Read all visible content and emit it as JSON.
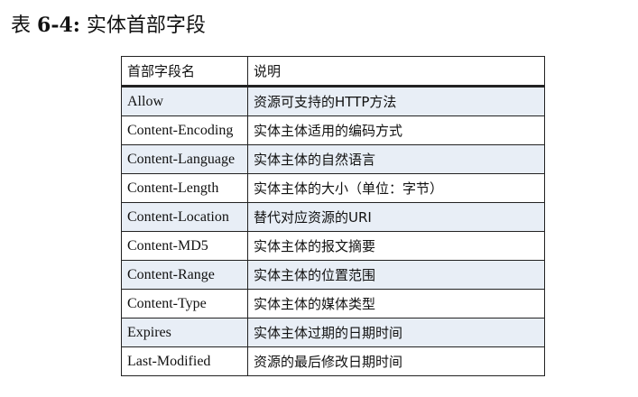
{
  "caption": {
    "prefix": "表",
    "number": "6-4:",
    "title": "实体首部字段"
  },
  "table": {
    "headers": {
      "name": "首部字段名",
      "desc": "说明"
    },
    "rows": [
      {
        "name": "Allow",
        "desc": "资源可支持的HTTP方法"
      },
      {
        "name": "Content-Encoding",
        "desc": "实体主体适用的编码方式"
      },
      {
        "name": "Content-Language",
        "desc": "实体主体的自然语言"
      },
      {
        "name": "Content-Length",
        "desc": "实体主体的大小（单位：字节）"
      },
      {
        "name": "Content-Location",
        "desc": "替代对应资源的URI"
      },
      {
        "name": "Content-MD5",
        "desc": "实体主体的报文摘要"
      },
      {
        "name": "Content-Range",
        "desc": "实体主体的位置范围"
      },
      {
        "name": "Content-Type",
        "desc": "实体主体的媒体类型"
      },
      {
        "name": "Expires",
        "desc": "实体主体过期的日期时间"
      },
      {
        "name": "Last-Modified",
        "desc": "资源的最后修改日期时间"
      }
    ]
  },
  "colors": {
    "row_stripe": "#e8eef6",
    "border": "#222222"
  }
}
